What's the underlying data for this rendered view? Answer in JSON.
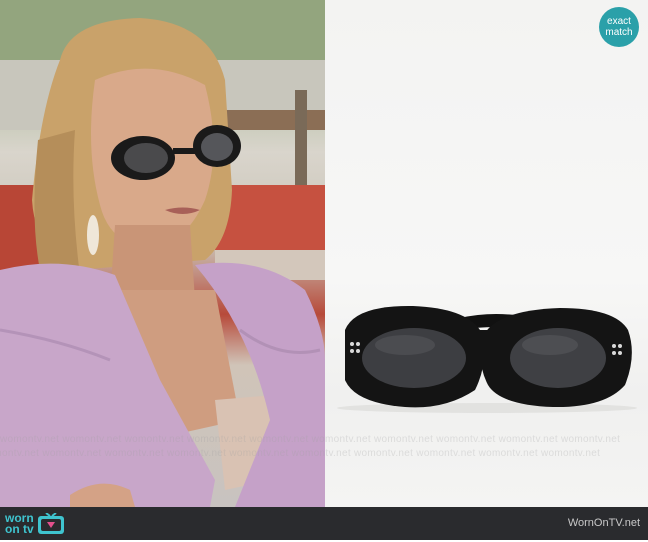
{
  "badge": {
    "line1": "exact",
    "line2": "match",
    "color": "#2aa0a9"
  },
  "watermark": {
    "text": "womontv.net",
    "rows": [
      "womontv.net womontv.net womontv.net womontv.net womontv.net womontv.net womontv.net womontv.net womontv.net womontv.net",
      "womontv.net womontv.net womontv.net womontv.net womontv.net womontv.net womontv.net womontv.net womontv.net womontv.net"
    ]
  },
  "footer": {
    "logo_line1": "worn",
    "logo_line2": "on tv",
    "site_name": "WornOnTV.net",
    "logo_color": "#3fc4cf",
    "background": "#2a2b2e"
  },
  "icons": {
    "logo": "tv-icon",
    "product": "sunglasses-image"
  }
}
